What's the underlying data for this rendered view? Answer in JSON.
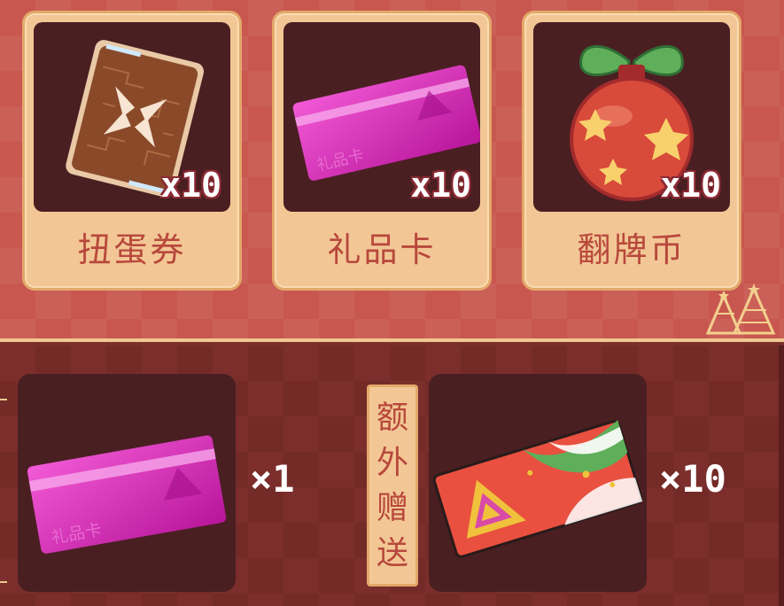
{
  "items": [
    {
      "label": "扭蛋券",
      "quantity": "x10",
      "icon": "gacha-ticket-icon"
    },
    {
      "label": "礼品卡",
      "quantity": "x10",
      "icon": "gift-card-icon"
    },
    {
      "label": "翻牌币",
      "quantity": "x10",
      "icon": "ornament-coin-icon"
    }
  ],
  "card_text": "礼品卡",
  "rewards": {
    "main_quantity": "×1",
    "bonus_label": [
      "额",
      "外",
      "赠",
      "送"
    ],
    "bonus_quantity": "×10"
  },
  "colors": {
    "panel": "#c8574f",
    "card": "#f2c795",
    "well": "#4a1f22",
    "label": "#b8483c",
    "gift_card": "#d92bb4"
  }
}
